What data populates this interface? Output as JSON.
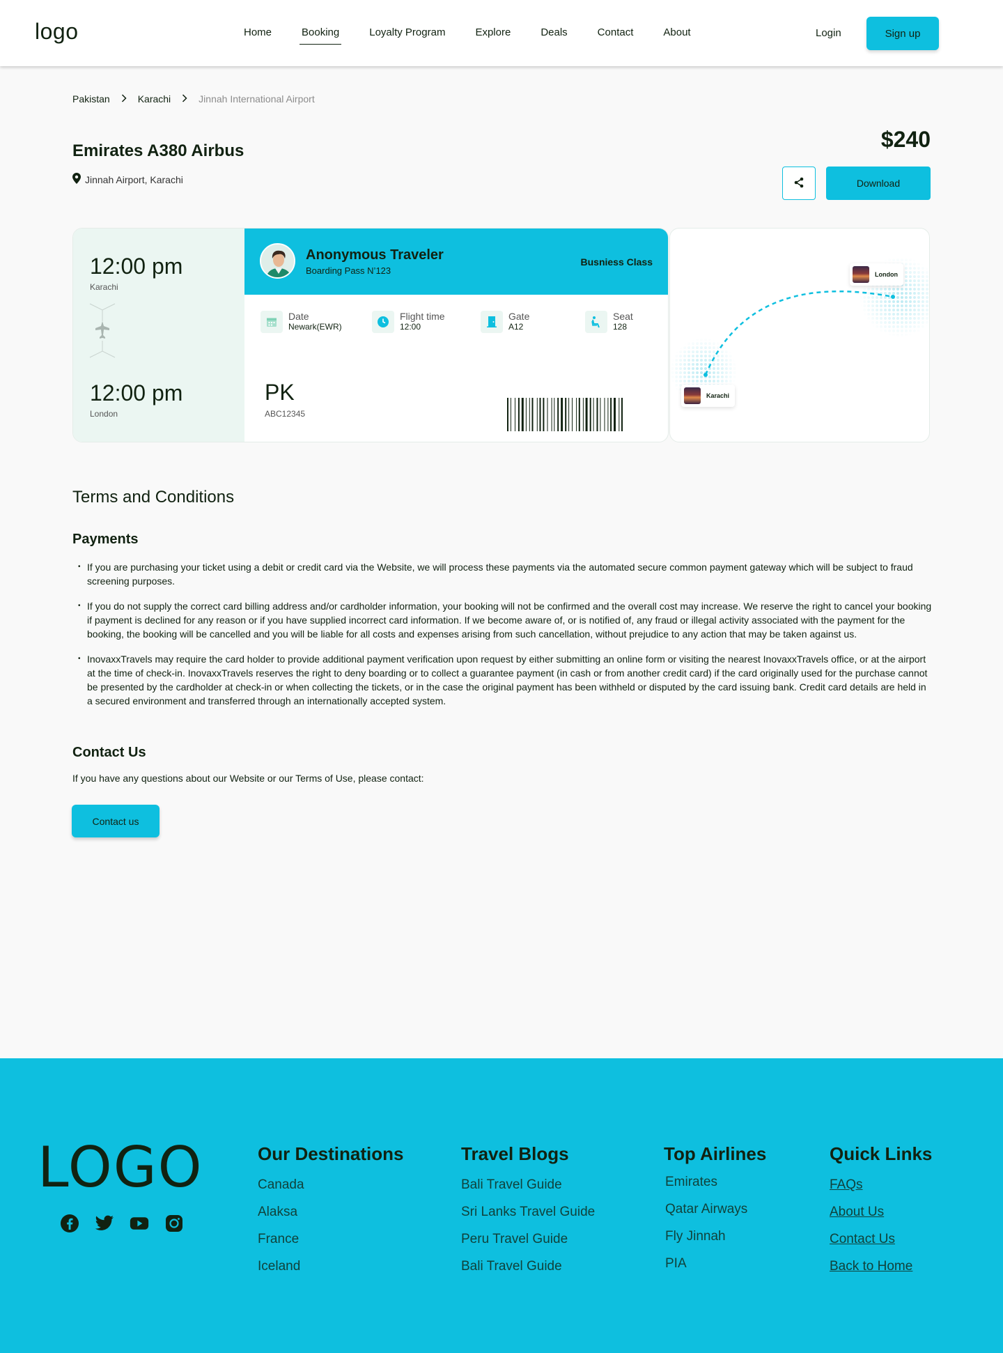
{
  "nav": {
    "logo": "logo",
    "links": [
      "Home",
      "Booking",
      "Loyalty Program",
      "Explore",
      "Deals",
      "Contact",
      "About"
    ],
    "active": "Booking",
    "login": "Login",
    "signup": "Sign up"
  },
  "breadcrumb": [
    "Pakistan",
    "Karachi",
    "Jinnah International Airport"
  ],
  "flight": {
    "title": "Emirates A380 Airbus",
    "location": "Jinnah Airport, Karachi",
    "price": "$240",
    "download": "Download"
  },
  "ticket": {
    "depart_time": "12:00 pm",
    "depart_city": "Karachi",
    "arrive_time": "12:00 pm",
    "arrive_city": "London",
    "traveler": "Anonymous Traveler",
    "boarding_pass": "Boarding Pass N’123",
    "class": "Busniess Class",
    "date_label": "Date",
    "date_value": "Newark(EWR)",
    "flight_time_label": "Flight time",
    "flight_time_value": "12:00",
    "gate_label": "Gate",
    "gate_value": "A12",
    "seat_label": "Seat",
    "seat_value": "128",
    "code": "PK",
    "code_sub": "ABC12345"
  },
  "map": {
    "from": "Karachi",
    "to": "London"
  },
  "terms": {
    "title": "Terms and Conditions",
    "payments_heading": "Payments",
    "bullets": [
      "If you are purchasing your ticket using a debit or credit card via the Website, we will process these payments via the automated secure common payment gateway which will be subject to fraud screening purposes.",
      "If you do not supply the correct card billing address and/or cardholder information, your booking will not be confirmed and the overall cost may increase. We reserve the right to cancel your booking if payment is declined for any reason or if you have supplied incorrect card information. If we become aware of, or is notified of, any fraud or illegal activity associated with the payment for the booking, the booking will be cancelled and you will be liable for all costs and expenses arising from such cancellation, without prejudice to any action that may be taken against us.",
      "InovaxxTravels may require the card holder to provide additional payment verification upon request by either submitting an online form or visiting the nearest InovaxxTravels office, or at the airport at the time of check-in. InovaxxTravels reserves the right to deny boarding or to collect a guarantee payment (in cash or from another credit card) if the card originally used for the purchase cannot be presented by the cardholder at check-in or when collecting the tickets, or in the case the original payment has been withheld or disputed by the card issuing bank. Credit card details are held in a secured environment and transferred through an internationally accepted system."
    ],
    "contact_heading": "Contact Us",
    "contact_text": "If you have any questions about our Website or our Terms of Use, please contact:",
    "contact_button": "Contact us"
  },
  "footer": {
    "logo": "LOGO",
    "socials": [
      "facebook-icon",
      "twitter-icon",
      "youtube-icon",
      "instagram-icon"
    ],
    "destinations": {
      "title": "Our Destinations",
      "items": [
        "Canada",
        "Alaksa",
        "France",
        "Iceland"
      ]
    },
    "blogs": {
      "title": "Travel Blogs",
      "items": [
        "Bali Travel Guide",
        "Sri Lanks Travel Guide",
        "Peru Travel Guide",
        "Bali Travel Guide"
      ]
    },
    "airlines": {
      "title": "Top Airlines",
      "items": [
        "Emirates",
        "Qatar Airways",
        "Fly Jinnah",
        "PIA"
      ]
    },
    "quick": {
      "title": "Quick Links",
      "items": [
        "FAQs",
        "About Us",
        "Contact Us",
        "Back to Home"
      ]
    }
  },
  "colors": {
    "accent": "#0ebfdf",
    "dark": "#112211",
    "mint": "#ebf6f2"
  }
}
